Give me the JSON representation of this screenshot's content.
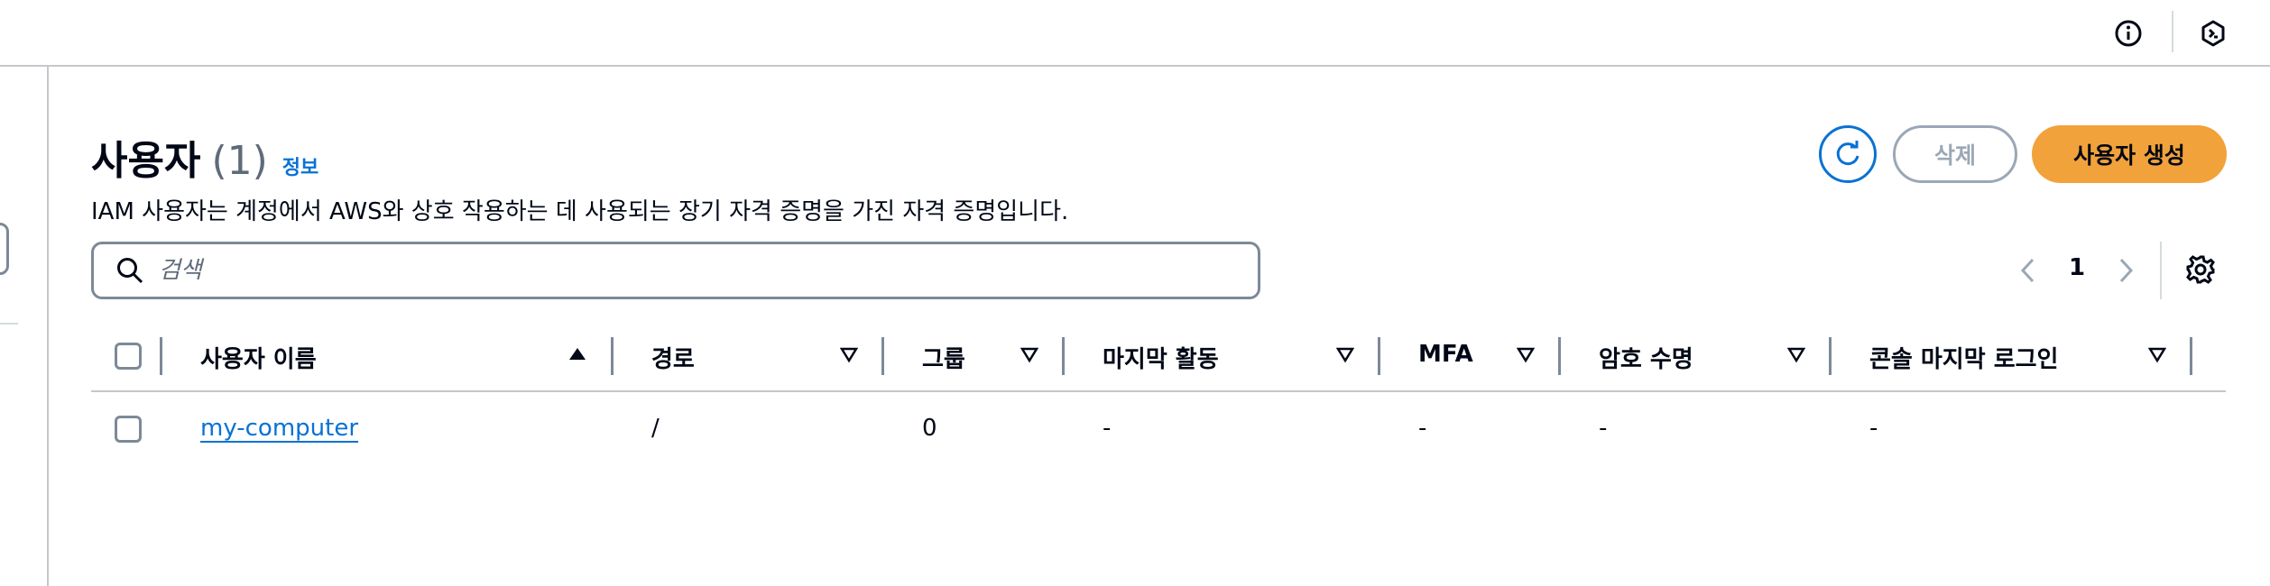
{
  "top_bar": {
    "icons": [
      "info-circle-icon",
      "cloudshell-icon"
    ]
  },
  "header": {
    "title": "사용자",
    "count": "(1)",
    "info_link": "정보",
    "description": "IAM 사용자는 계정에서 AWS와 상호 작용하는 데 사용되는 장기 자격 증명을 가진 자격 증명입니다."
  },
  "actions": {
    "refresh_icon": "refresh-icon",
    "delete_label": "삭제",
    "create_label": "사용자 생성"
  },
  "search": {
    "placeholder": "검색",
    "value": ""
  },
  "pagination": {
    "current_page": "1"
  },
  "table": {
    "columns": [
      {
        "label": "사용자 이름",
        "sort": "ascending"
      },
      {
        "label": "경로",
        "sort": "none"
      },
      {
        "label": "그룹",
        "sort": "none"
      },
      {
        "label": "마지막 활동",
        "sort": "none"
      },
      {
        "label": "MFA",
        "sort": "none"
      },
      {
        "label": "암호 수명",
        "sort": "none"
      },
      {
        "label": "콘솔 마지막 로그인",
        "sort": "none"
      }
    ],
    "rows": [
      {
        "user_name": "my-computer",
        "path": "/",
        "groups": "0",
        "last_activity": "-",
        "mfa": "-",
        "password_age": "-",
        "console_last_sign_in": "-"
      }
    ]
  },
  "colors": {
    "primary_blue": "#0972d3",
    "create_button": "#f2a23a",
    "disabled": "#9ba7b6",
    "border": "#7d8998"
  }
}
